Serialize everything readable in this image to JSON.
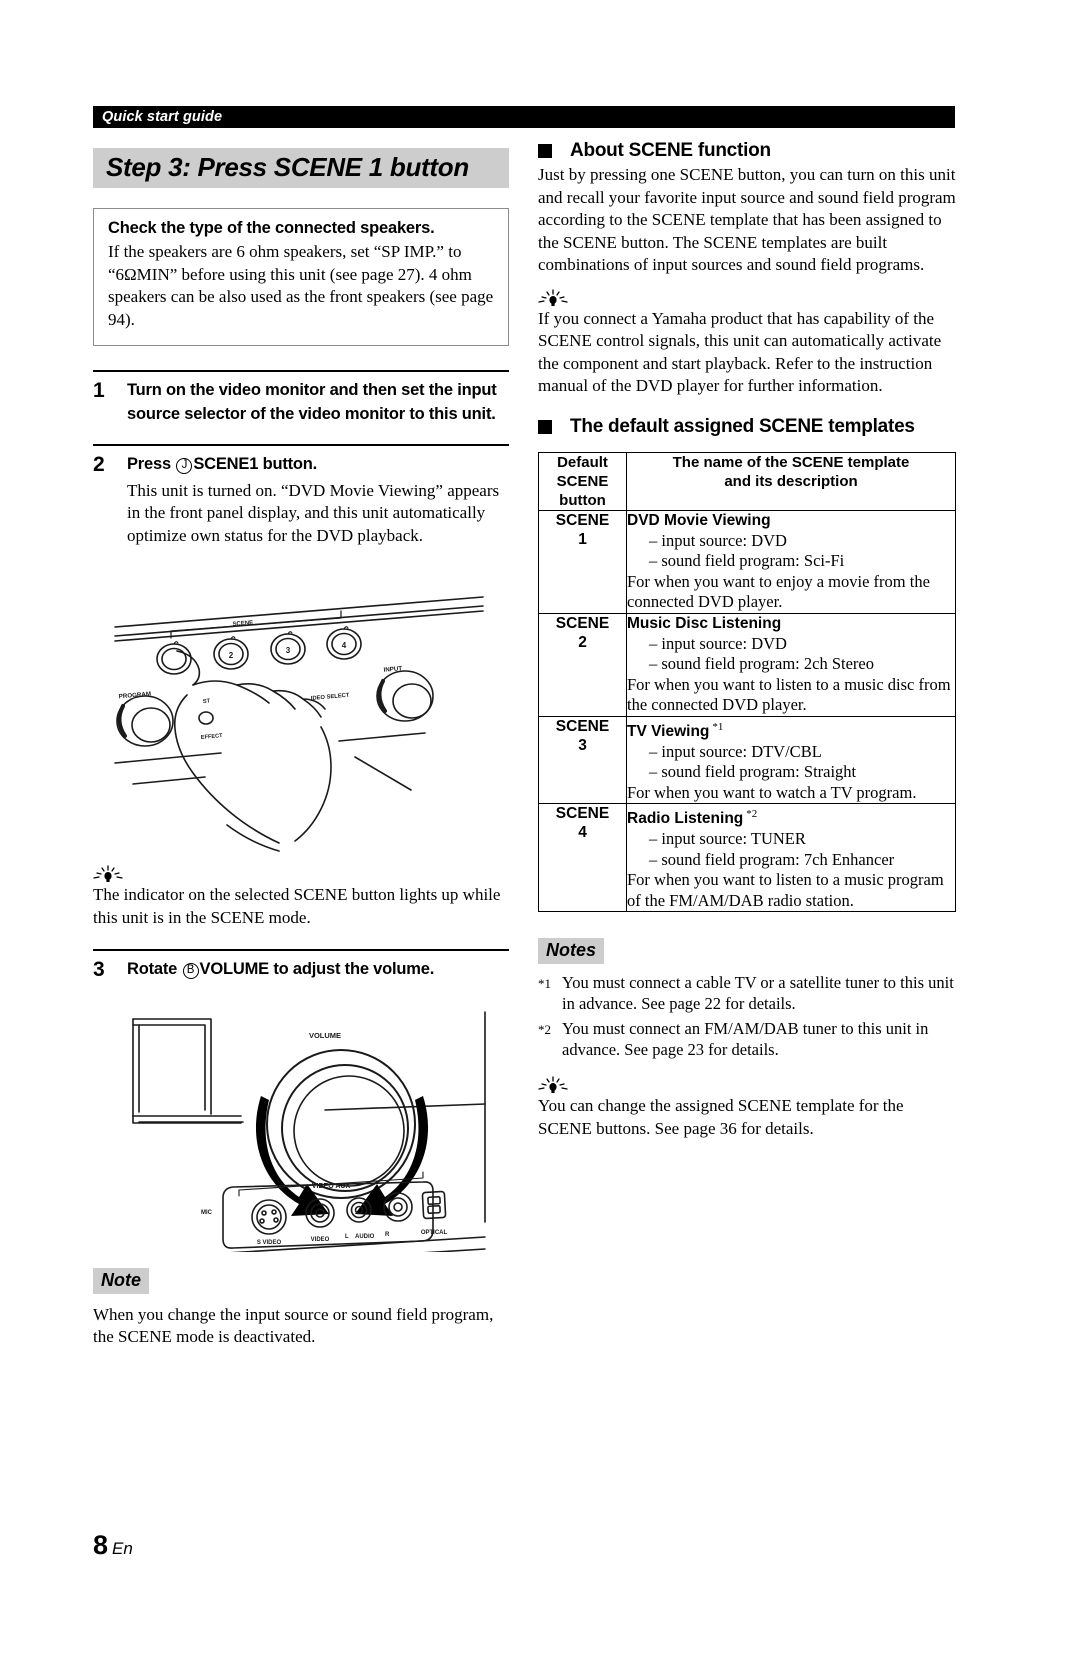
{
  "running_header": "Quick start guide",
  "page_number": {
    "number": "8",
    "lang": "En"
  },
  "left": {
    "step_banner": "Step 3: Press SCENE 1 button",
    "speaker_box": {
      "title": "Check the type of the connected speakers.",
      "body": "If the speakers are 6 ohm speakers, set “SP IMP.” to “6ΩMIN” before using this unit (see page 27). 4 ohm speakers can be also used as the front speakers (see page 94)."
    },
    "steps": [
      {
        "number": "1",
        "heading": "Turn on the video monitor and then set the input source selector of the video monitor to this unit.",
        "body": ""
      },
      {
        "number": "2",
        "heading_pre": "Press",
        "heading_circle": "J",
        "heading_bold": "SCENE1",
        "heading_post": "button.",
        "body": "This unit is turned on. “DVD Movie Viewing” appears in the front panel display, and this unit automatically optimize own status for the DVD playback."
      },
      {
        "number": "3",
        "heading_pre": "Rotate",
        "heading_circle": "B",
        "heading_bold": "VOLUME",
        "heading_post": "to adjust the volume.",
        "body": ""
      }
    ],
    "scene_figure": {
      "label_scene": "SCENE",
      "label_program": "PROGRAM",
      "label_input": "INPUT",
      "label_straight": "STRAIGHT",
      "label_effect": "EFFECT",
      "label_select": "SELECT",
      "buttons": [
        "1",
        "2",
        "3",
        "4"
      ]
    },
    "volume_figure": {
      "label_volume": "VOLUME",
      "label_video_aux": "VIDEO AUX",
      "label_mic": "MIC",
      "label_svideo": "S VIDEO",
      "label_video": "VIDEO",
      "label_audio_l": "L",
      "label_audio": "AUDIO",
      "label_audio_r": "R",
      "label_optical": "OPTICAL"
    },
    "tip": "The indicator on the selected SCENE button lights up while this unit is in the SCENE mode.",
    "note_badge": "Note",
    "note_text": "When you change the input source or sound field program, the SCENE mode is deactivated."
  },
  "right": {
    "about_heading": "About SCENE function",
    "about_body": "Just by pressing one SCENE button, you can turn on this unit and recall your favorite input source and sound field program according to the SCENE template that has been assigned to the SCENE button. The SCENE templates are built combinations of input sources and sound field programs.",
    "about_tip": "If you connect a Yamaha product that has capability of the SCENE control signals, this unit can automatically activate the component and start playback. Refer to the instruction manual of the DVD player for further information.",
    "templates_heading": "The default assigned SCENE templates",
    "table": {
      "header_left": "Default SCENE button",
      "header_left_lines": [
        "Default",
        "SCENE",
        "button"
      ],
      "header_right_lines": [
        "The name of the SCENE template",
        "and its description"
      ],
      "rows": [
        {
          "button_lines": [
            "SCENE",
            "1"
          ],
          "name": "DVD Movie Viewing",
          "footnote": "",
          "bullets": [
            "– input source: DVD",
            "– sound field program: Sci-Fi"
          ],
          "description": "For when you want to enjoy a movie from the connected DVD player."
        },
        {
          "button_lines": [
            "SCENE",
            "2"
          ],
          "name": "Music Disc Listening",
          "footnote": "",
          "bullets": [
            "– input source: DVD",
            "– sound field program: 2ch Stereo"
          ],
          "description": "For when you want to listen to a music disc from the connected DVD player."
        },
        {
          "button_lines": [
            "SCENE",
            "3"
          ],
          "name": "TV Viewing",
          "footnote": "*1",
          "bullets": [
            "– input source: DTV/CBL",
            "– sound field program: Straight"
          ],
          "description": "For when you want to watch a TV program."
        },
        {
          "button_lines": [
            "SCENE",
            "4"
          ],
          "name": "Radio Listening",
          "footnote": "*2",
          "bullets": [
            "– input source: TUNER",
            "– sound field program: 7ch Enhancer"
          ],
          "description": "For when you want to listen to a music program of the FM/AM/DAB radio station."
        }
      ]
    },
    "notes_badge": "Notes",
    "footnotes": [
      {
        "mark": "*1",
        "text": "You must connect a cable TV or a satellite tuner to this unit in advance. See page 22 for details."
      },
      {
        "mark": "*2",
        "text": "You must connect an FM/AM/DAB tuner to this unit in advance. See page 23 for details."
      }
    ],
    "bottom_tip": "You can change the assigned SCENE template for the SCENE buttons. See page 36 for details."
  }
}
